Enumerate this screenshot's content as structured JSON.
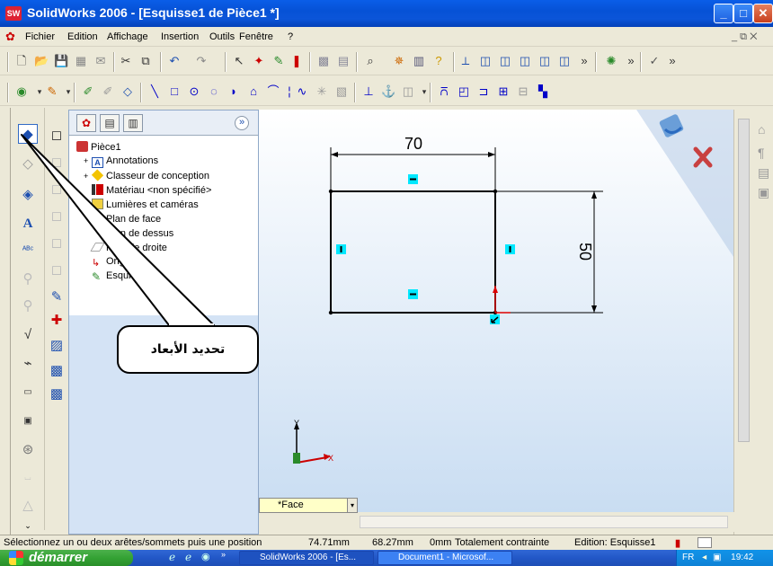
{
  "window": {
    "title": "SolidWorks 2006 - [Esquisse1 de Pièce1 *]",
    "logo": "SW",
    "min_label": "_",
    "max_label": "□",
    "close_label": "✕"
  },
  "menu": {
    "items": [
      "Fichier",
      "Edition",
      "Affichage",
      "Insertion",
      "Outils",
      "Fenêtre",
      "?"
    ],
    "doc_controls": "_ ⧉ ✕"
  },
  "feature_manager": {
    "collapse_label": "»",
    "tree": [
      {
        "label": "Pièce1",
        "icon": "part-icon"
      },
      {
        "label": "Annotations",
        "icon": "annotations-icon",
        "expander": "+"
      },
      {
        "label": "Classeur de conception",
        "icon": "design-binder-icon",
        "expander": "+"
      },
      {
        "label": "Matériau <non spécifié>",
        "icon": "material-icon"
      },
      {
        "label": "Lumières et caméras",
        "icon": "lights-icon",
        "expander": "+"
      },
      {
        "label": "Plan de face",
        "icon": "plane-icon"
      },
      {
        "label": "Plan de dessus",
        "icon": "plane-icon"
      },
      {
        "label": "Plan de droite",
        "icon": "plane-icon"
      },
      {
        "label": "Origine",
        "icon": "origin-icon"
      },
      {
        "label": "Esquisse1",
        "icon": "sketch-icon"
      }
    ]
  },
  "sketch": {
    "dim_horizontal": "70",
    "dim_vertical": "50",
    "axis_x": "X",
    "axis_y": "Y"
  },
  "callout": {
    "text": "تحديد الأبعاد"
  },
  "view_selector": {
    "value": "*Face"
  },
  "status": {
    "message": "Sélectionnez un ou deux arêtes/sommets puis une position",
    "x": "74.71mm",
    "y": "68.27mm",
    "z": "0mm",
    "constraint": "Totalement contrainte",
    "edition": "Edition: Esquisse1"
  },
  "taskbar": {
    "start": "démarrer",
    "tasks": [
      "SolidWorks 2006 - [Es...",
      "Document1 - Microsof..."
    ],
    "lang": "FR",
    "time": "19:42"
  },
  "colors": {
    "titlebar": "#0652d6",
    "sketch_line": "#000000",
    "relation_marker": "#00e8ff",
    "start_button": "#34a234"
  }
}
